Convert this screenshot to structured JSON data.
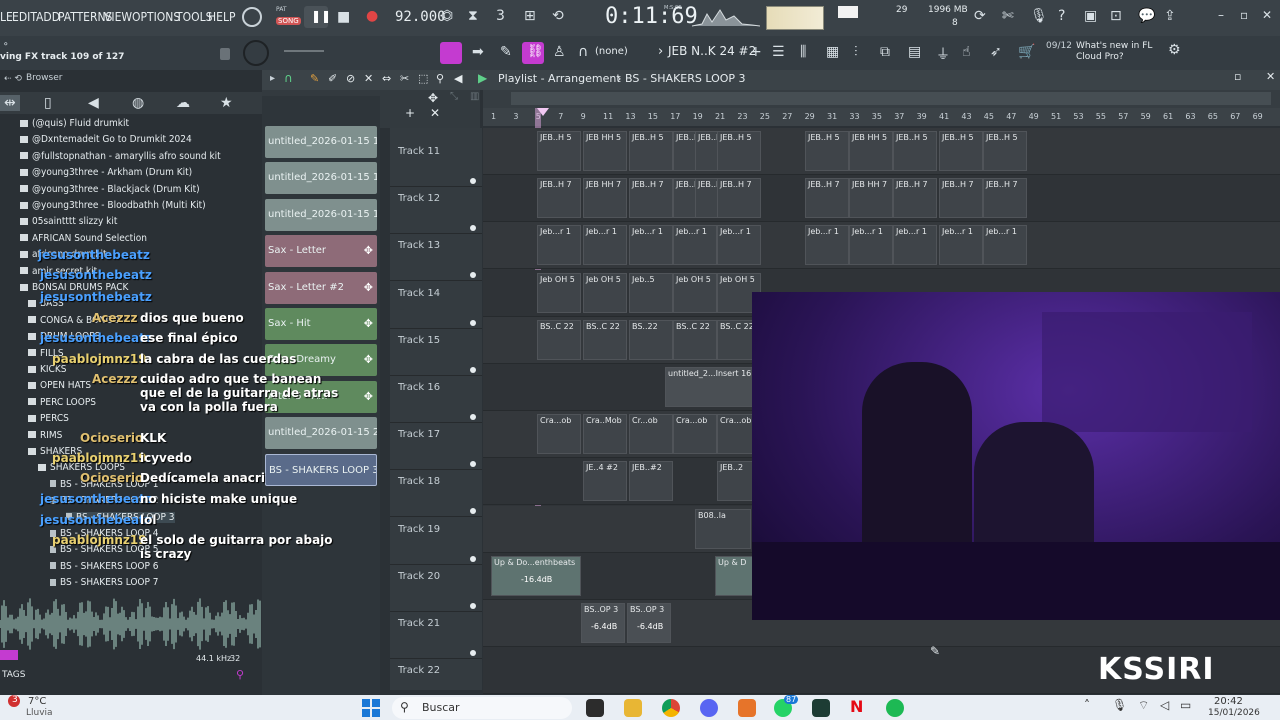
{
  "menu": [
    "LE",
    "EDIT",
    "ADD",
    "PATTERNS",
    "VIEW",
    "OPTIONS",
    "TOOLS",
    "HELP"
  ],
  "transport": {
    "mode": "SONG",
    "tempo": "92.000",
    "time": "0:11:69",
    "time_label": "M:S:CS",
    "cpu": "29",
    "ram": "1996 MB",
    "ram_sub": "8"
  },
  "hint": {
    "line1": "ving FX track 109 of 127"
  },
  "toolbar": {
    "snap": "(none)",
    "pattern": "JEB N..K 24 #2",
    "news_date": "09/12",
    "news_text": "What's new in FL Cloud Pro?"
  },
  "browser": {
    "title": "Browser",
    "items": [
      {
        "label": "(@quis) Fluid drumkit",
        "kind": "folder"
      },
      {
        "label": "@Dxntemadeit Go to Drumkit 2024",
        "kind": "folder"
      },
      {
        "label": "@fullstopnathan - amaryllis afro sound kit",
        "kind": "folder"
      },
      {
        "label": "@young3three - Arkham (Drum Kit)",
        "kind": "folder"
      },
      {
        "label": "@young3three - Blackjack (Drum Kit)",
        "kind": "folder"
      },
      {
        "label": "@young3three - Bloodbathh (Multi Kit)",
        "kind": "folder"
      },
      {
        "label": "05saintttt slizzy kit",
        "kind": "folder"
      },
      {
        "label": "AFRICAN Sound Selection",
        "kind": "folder"
      },
      {
        "label": "africano drumkit",
        "kind": "folder"
      },
      {
        "label": "amir secret kit",
        "kind": "folder"
      },
      {
        "label": "BONSAI DRUMS PACK",
        "kind": "folder"
      },
      {
        "label": "BASS",
        "kind": "sub"
      },
      {
        "label": "CONGA & BONGO",
        "kind": "sub"
      },
      {
        "label": "DRUM LOOPS",
        "kind": "sub"
      },
      {
        "label": "FILLS",
        "kind": "sub"
      },
      {
        "label": "KICKS",
        "kind": "sub"
      },
      {
        "label": "OPEN HATS",
        "kind": "sub"
      },
      {
        "label": "PERC LOOPS",
        "kind": "sub"
      },
      {
        "label": "PERCS",
        "kind": "sub"
      },
      {
        "label": "RIMS",
        "kind": "sub"
      },
      {
        "label": "SHAKERS",
        "kind": "sub"
      },
      {
        "label": "SHAKERS LOOPS",
        "kind": "sub2"
      },
      {
        "label": "BS - SHAKERS LOOP 1",
        "kind": "file"
      },
      {
        "label": "BS - SHAKERS LOOP 2",
        "kind": "file"
      },
      {
        "label": "BS - SHAKERS LOOP 3",
        "kind": "file-selected"
      },
      {
        "label": "BS - SHAKERS LOOP 4",
        "kind": "file"
      },
      {
        "label": "BS - SHAKERS LOOP 5",
        "kind": "file"
      },
      {
        "label": "BS - SHAKERS LOOP 6",
        "kind": "file"
      },
      {
        "label": "BS - SHAKERS LOOP 7",
        "kind": "file"
      }
    ],
    "samplerate": "44.1 kHz",
    "bits": "32",
    "tags": "TAGS"
  },
  "picker": [
    {
      "label": "untitled_2026-01-15 19-...",
      "color": "#7f908e"
    },
    {
      "label": "untitled_2026-01-15 19-...",
      "color": "#7f908e"
    },
    {
      "label": "untitled_2026-01-15 19-...",
      "color": "#7f908e"
    },
    {
      "label": "Sax - Letter",
      "color": "#8e6b78"
    },
    {
      "label": "Sax - Letter #2",
      "color": "#8e6b78"
    },
    {
      "label": "Sax - Hit",
      "color": "#5f8a5e"
    },
    {
      "label": "Sax - Dreamy",
      "color": "#5f8a5e"
    },
    {
      "label": "After 5 - A...",
      "color": "#5f8a5e"
    },
    {
      "label": "untitled_2026-01-15 20-...",
      "color": "#7f908e"
    },
    {
      "label": "BS - SHAKERS LOOP 3",
      "color": "#5a6b8a"
    }
  ],
  "playlist": {
    "title": "Playlist - Arrangement",
    "pattern": "BS - SHAKERS LOOP 3",
    "ruler": [
      "1",
      "3",
      "5",
      "7",
      "9",
      "11",
      "13",
      "15",
      "17",
      "19",
      "21",
      "23",
      "25",
      "27",
      "29",
      "31",
      "33",
      "35",
      "37",
      "39",
      "41",
      "43",
      "45",
      "47",
      "49",
      "51",
      "53",
      "55",
      "57",
      "59",
      "61",
      "63",
      "65",
      "67",
      "69"
    ],
    "tracks": [
      "Track 11",
      "Track 12",
      "Track 13",
      "Track 14",
      "Track 15",
      "Track 16",
      "Track 17",
      "Track 18",
      "Track 19",
      "Track 20",
      "Track 21",
      "Track 22"
    ],
    "clips": {
      "t11": "JEB..H 5",
      "t11b": "JEB HH 5",
      "t12": "JEB..H 7",
      "t12b": "JEB HH 7",
      "t13": "Jeb...r 1",
      "t14": "Jeb OH 5",
      "t14b": "Jeb..5",
      "t15": "BS..C 22",
      "t15b": "BS..22",
      "t16": "untitled_2...Insert 16",
      "t17": "Cra...ob",
      "t17b": "Cra..Mob",
      "t17c": "Cr...ob",
      "t18": "JE..4 #2",
      "t18b": "JEB..#2",
      "t18c": "JEB..2",
      "t19": "B08..la",
      "t20": "Up & Do...enthbeats",
      "t20b": "Up & D",
      "t20db": "-16.4dB",
      "t21": "BS..OP 3",
      "t21db": "-6.4dB"
    }
  },
  "chat": [
    {
      "user": "Acezzz",
      "text": "dios que bueno"
    },
    {
      "user": "jesusonthebeatz",
      "text": "ese final épico"
    },
    {
      "user": "paablojmnz19",
      "text": "la cabra de las cuerdas"
    },
    {
      "user": "Acezzz",
      "text": "cuidao adro que te banean que el de la guitarra de atras va con la polla fuera"
    },
    {
      "user": "Ocioserio",
      "text": "KLK"
    },
    {
      "user": "paablojmnz19",
      "text": "icyvedo"
    },
    {
      "user": "Ocioserio",
      "text": "Dedícamela anacri"
    },
    {
      "user": "jesusonthebeatz",
      "text": "no hiciste make unique"
    },
    {
      "user": "jesusonthebeatz",
      "text": "lol"
    },
    {
      "user": "paablojmnz19",
      "text": "el solo de guitarra por abajo is crazy"
    }
  ],
  "chat_extra": {
    "user": "jesusonthebeatz"
  },
  "watermark": "KSSIRI",
  "taskbar": {
    "weather_temp": "7°C",
    "weather_desc": "Lluvia",
    "badge": "3",
    "search": "Buscar",
    "whatsapp_badge": "87",
    "time": "20:42",
    "date": "15/01/2026"
  },
  "colors": {
    "accent": "#e03ce6",
    "topbar": "#3a4248",
    "grid": "#303438"
  }
}
